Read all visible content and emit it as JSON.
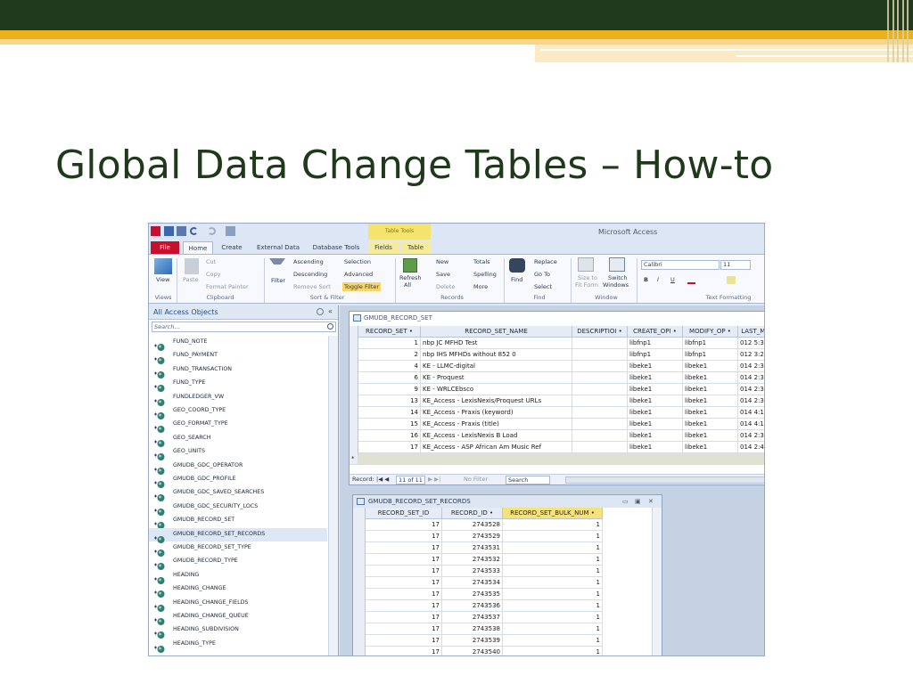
{
  "slide": {
    "title": "Global Data Change Tables – How-to",
    "colors": {
      "dark_band": "#1f3a1c",
      "gold_band": "#e9b21c",
      "title_text": "#1e3a1a"
    }
  },
  "access": {
    "app_title": "Microsoft Access",
    "context_tab": "Table Tools",
    "tabs": [
      "File",
      "Home",
      "Create",
      "External Data",
      "Database Tools",
      "Fields",
      "Table"
    ],
    "ribbon": {
      "views": {
        "view_label": "View",
        "group": "Views"
      },
      "clipboard": {
        "paste": "Paste",
        "cut": "Cut",
        "copy": "Copy",
        "format_painter": "Format Painter",
        "group": "Clipboard"
      },
      "sort_filter": {
        "filter": "Filter",
        "ascending": "Ascending",
        "descending": "Descending",
        "remove_sort": "Remove Sort",
        "selection": "Selection",
        "advanced": "Advanced",
        "toggle_filter": "Toggle Filter",
        "group": "Sort & Filter"
      },
      "records": {
        "refresh": "Refresh",
        "refresh_sub": "All",
        "new": "New",
        "save": "Save",
        "delete": "Delete",
        "totals": "Totals",
        "spelling": "Spelling",
        "more": "More",
        "group": "Records"
      },
      "find": {
        "find": "Find",
        "replace": "Replace",
        "go_to": "Go To",
        "select": "Select",
        "group": "Find"
      },
      "window": {
        "size_to": "Size to",
        "fit_form": "Fit Form",
        "switch": "Switch",
        "windows": "Windows",
        "group": "Window"
      },
      "text_formatting": {
        "font": "Calibri",
        "size": "11",
        "bold": "B",
        "italic": "I",
        "underline": "U",
        "group": "Text Formatting"
      }
    },
    "nav": {
      "header": "All Access Objects",
      "search_placeholder": "Search...",
      "selected": "GMUDB_RECORD_SET_RECORDS",
      "items": [
        "FUND_NOTE",
        "FUND_PAYMENT",
        "FUND_TRANSACTION",
        "FUND_TYPE",
        "FUNDLEDGER_VW",
        "GEO_COORD_TYPE",
        "GEO_FORMAT_TYPE",
        "GEO_SEARCH",
        "GEO_UNITS",
        "GMUDB_GDC_OPERATOR",
        "GMUDB_GDC_PROFILE",
        "GMUDB_GDC_SAVED_SEARCHES",
        "GMUDB_GDC_SECURITY_LOCS",
        "GMUDB_RECORD_SET",
        "GMUDB_RECORD_SET_RECORDS",
        "GMUDB_RECORD_SET_TYPE",
        "GMUDB_RECORD_TYPE",
        "HEADING",
        "HEADING_CHANGE",
        "HEADING_CHANGE_FIELDS",
        "HEADING_CHANGE_QUEUE",
        "HEADING_SUBDIVISION",
        "HEADING_TYPE"
      ]
    },
    "record_set": {
      "tab_title": "GMUDB_RECORD_SET",
      "columns": [
        "RECORD_SET •",
        "RECORD_SET_NAME",
        "DESCRIPTIOI •",
        "CREATE_OPI •",
        "MODIFY_OP •",
        "LAST_MO"
      ],
      "rows": [
        [
          "1",
          "nbp JC MFHD Test",
          "",
          "libfnp1",
          "libfnp1",
          "012 5:36:"
        ],
        [
          "2",
          "nbp IHS MFHDs without 852 0",
          "",
          "libfnp1",
          "libfnp1",
          "012 3:26:"
        ],
        [
          "4",
          "KE - LLMC-digital",
          "",
          "libeke1",
          "libeke1",
          "014 2:38:"
        ],
        [
          "6",
          "KE - Proquest",
          "",
          "libeke1",
          "libeke1",
          "014 2:39:"
        ],
        [
          "9",
          "KE - WRLCEbsco",
          "",
          "libeke1",
          "libeke1",
          "014 2:38:"
        ],
        [
          "13",
          "KE_Access - LexisNexis/Proquest URLs",
          "",
          "libeke1",
          "libeke1",
          "014 2:39:"
        ],
        [
          "14",
          "KE_Access - Praxis (keyword)",
          "",
          "libeke1",
          "libeke1",
          "014 4:11:"
        ],
        [
          "15",
          "KE_Access - Praxis (title)",
          "",
          "libeke1",
          "libeke1",
          "014 4:13:"
        ],
        [
          "16",
          "KE_Access - LexisNexis B Load",
          "",
          "libeke1",
          "libeke1",
          "014 2:39:"
        ],
        [
          "17",
          "KE_Access - ASP African Am Music Ref",
          "",
          "libeke1",
          "libeke1",
          "014 2:48:"
        ]
      ],
      "record_nav": {
        "record_label": "Record:",
        "position": "11 of 11",
        "filter": "No Filter",
        "search": "Search"
      }
    },
    "record_set_records": {
      "title": "GMUDB_RECORD_SET_RECORDS",
      "columns": [
        "RECORD_SET_ID",
        "RECORD_ID •",
        "RECORD_SET_BULK_NUM •"
      ],
      "rows": [
        [
          "17",
          "2743528",
          "1"
        ],
        [
          "17",
          "2743529",
          "1"
        ],
        [
          "17",
          "2743531",
          "1"
        ],
        [
          "17",
          "2743532",
          "1"
        ],
        [
          "17",
          "2743533",
          "1"
        ],
        [
          "17",
          "2743534",
          "1"
        ],
        [
          "17",
          "2743535",
          "1"
        ],
        [
          "17",
          "2743536",
          "1"
        ],
        [
          "17",
          "2743537",
          "1"
        ],
        [
          "17",
          "2743538",
          "1"
        ],
        [
          "17",
          "2743539",
          "1"
        ],
        [
          "17",
          "2743540",
          "1"
        ]
      ]
    }
  }
}
